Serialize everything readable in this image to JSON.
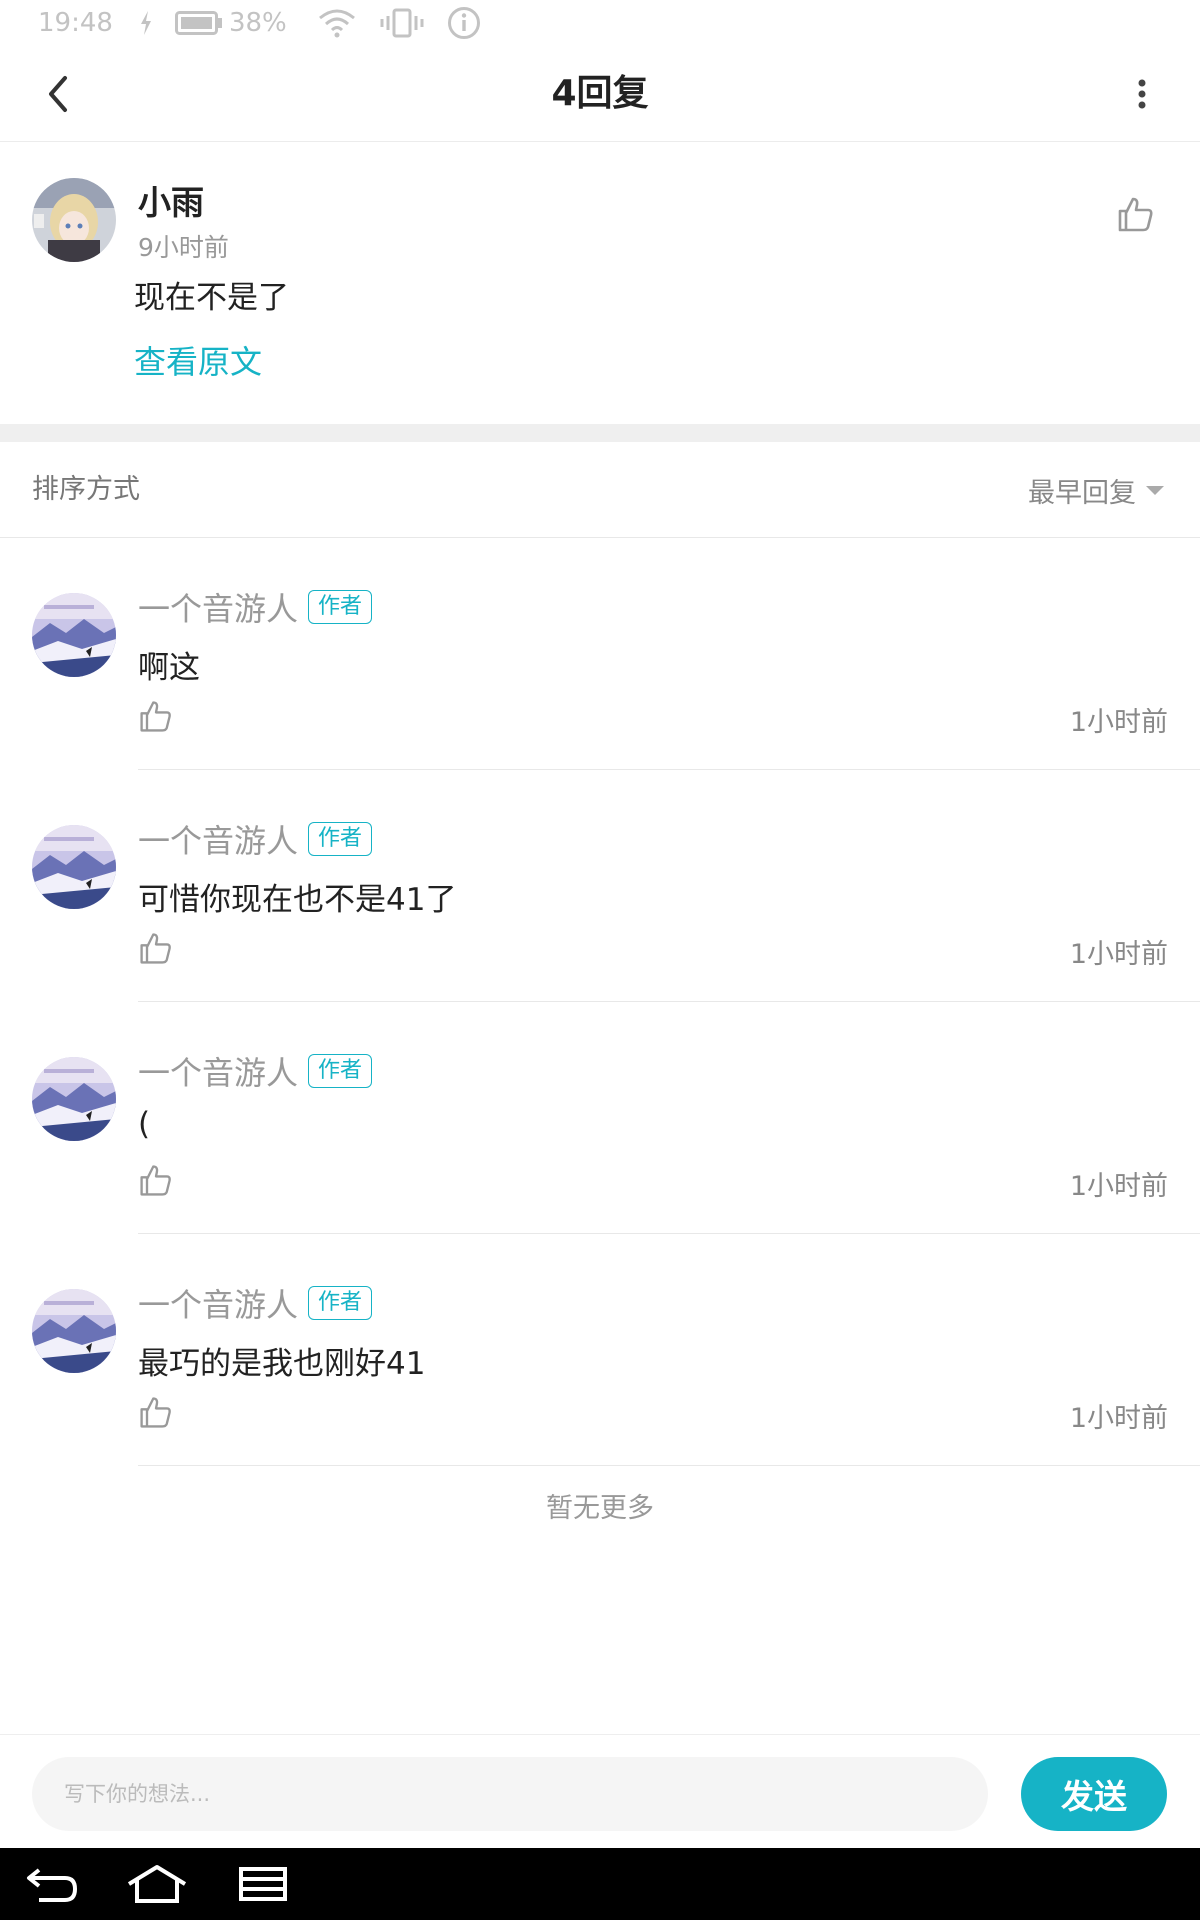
{
  "status_bar": {
    "time": "19:48",
    "battery": "38%"
  },
  "header": {
    "title": "4回复"
  },
  "original": {
    "author": "小雨",
    "time": "9小时前",
    "content": "现在不是了",
    "view_original": "查看原文"
  },
  "sort": {
    "label": "排序方式",
    "value": "最早回复"
  },
  "replies": [
    {
      "name": "一个音游人",
      "badge": "作者",
      "text": "啊这",
      "time": "1小时前"
    },
    {
      "name": "一个音游人",
      "badge": "作者",
      "text": "可惜你现在也不是41了",
      "time": "1小时前"
    },
    {
      "name": "一个音游人",
      "badge": "作者",
      "text": "(",
      "time": "1小时前"
    },
    {
      "name": "一个音游人",
      "badge": "作者",
      "text": "最巧的是我也刚好41",
      "time": "1小时前"
    }
  ],
  "footer": {
    "no_more": "暂无更多"
  },
  "input": {
    "placeholder": "写下你的想法...",
    "send_label": "发送"
  },
  "colors": {
    "accent": "#16b3c6"
  }
}
